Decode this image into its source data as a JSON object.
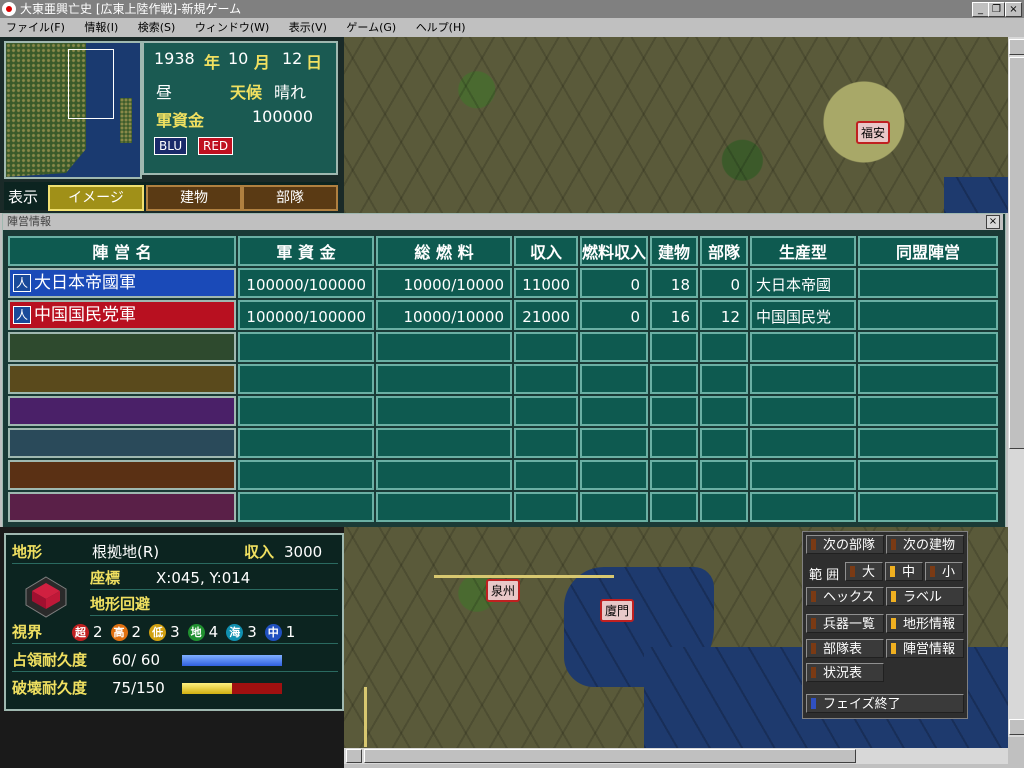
{
  "window": {
    "title": "大東亜興亡史 [広東上陸作戦]-新規ゲーム"
  },
  "menu": [
    {
      "label": "ファイル(F)"
    },
    {
      "label": "情報(I)"
    },
    {
      "label": "検索(S)"
    },
    {
      "label": "ウィンドウ(W)"
    },
    {
      "label": "表示(V)"
    },
    {
      "label": "ゲーム(G)"
    },
    {
      "label": "ヘルプ(H)"
    }
  ],
  "info": {
    "year": "1938",
    "year_unit": "年",
    "month": "10",
    "month_unit": "月",
    "day": "12",
    "day_unit": "日",
    "time_of_day": "昼",
    "weather_label": "天候",
    "weather": "晴れ",
    "funds_label": "軍資金",
    "funds": "100000",
    "side_blue": "BLU",
    "side_red": "RED"
  },
  "display_tabs": {
    "label": "表示",
    "tabs": [
      "イメージ",
      "建物",
      "部隊"
    ]
  },
  "map_labels": {
    "town_top": "福安",
    "town_left": "泉州",
    "town_right": "廈門"
  },
  "faction_dialog": {
    "title": "陣営情報",
    "close": "×",
    "headers": [
      "陣 営 名",
      "軍 資 金",
      "総 燃 料",
      "収入",
      "燃料収入",
      "建物",
      "部隊",
      "生産型",
      "同盟陣営"
    ],
    "rows": [
      {
        "icon": "人",
        "name": "大日本帝國軍",
        "funds": "100000/100000",
        "fuel": "10000/10000",
        "income": "11000",
        "fuel_income": "0",
        "buildings": "18",
        "units": "0",
        "production": "大日本帝國",
        "alliance": "",
        "color": "#1a4ab8"
      },
      {
        "icon": "人",
        "name": "中国国民党軍",
        "funds": "100000/100000",
        "fuel": "10000/10000",
        "income": "21000",
        "fuel_income": "0",
        "buildings": "16",
        "units": "12",
        "production": "中国国民党",
        "alliance": "",
        "color": "#b81020"
      },
      {
        "icon": "",
        "name": "",
        "funds": "",
        "fuel": "",
        "income": "",
        "fuel_income": "",
        "buildings": "",
        "units": "",
        "production": "",
        "alliance": "",
        "color": "#2e4a2e"
      },
      {
        "icon": "",
        "name": "",
        "funds": "",
        "fuel": "",
        "income": "",
        "fuel_income": "",
        "buildings": "",
        "units": "",
        "production": "",
        "alliance": "",
        "color": "#5a4a1c"
      },
      {
        "icon": "",
        "name": "",
        "funds": "",
        "fuel": "",
        "income": "",
        "fuel_income": "",
        "buildings": "",
        "units": "",
        "production": "",
        "alliance": "",
        "color": "#4a2068"
      },
      {
        "icon": "",
        "name": "",
        "funds": "",
        "fuel": "",
        "income": "",
        "fuel_income": "",
        "buildings": "",
        "units": "",
        "production": "",
        "alliance": "",
        "color": "#2a4a5a"
      },
      {
        "icon": "",
        "name": "",
        "funds": "",
        "fuel": "",
        "income": "",
        "fuel_income": "",
        "buildings": "",
        "units": "",
        "production": "",
        "alliance": "",
        "color": "#5a3014"
      },
      {
        "icon": "",
        "name": "",
        "funds": "",
        "fuel": "",
        "income": "",
        "fuel_income": "",
        "buildings": "",
        "units": "",
        "production": "",
        "alliance": "",
        "color": "#5a2048"
      }
    ]
  },
  "terrain": {
    "terrain_label": "地形",
    "terrain_value": "根拠地(R)",
    "income_label": "収入",
    "income_value": "3000",
    "coord_label": "座標",
    "coord_value": "X:045, Y:014",
    "evasion_label": "地形回避",
    "vision_label": "視界",
    "vision": [
      {
        "icon": "超",
        "value": "2",
        "color": "#c02020"
      },
      {
        "icon": "高",
        "value": "2",
        "color": "#e07010"
      },
      {
        "icon": "低",
        "value": "3",
        "color": "#d0a010"
      },
      {
        "icon": "地",
        "value": "4",
        "color": "#209030"
      },
      {
        "icon": "海",
        "value": "3",
        "color": "#1090b0"
      },
      {
        "icon": "中",
        "value": "1",
        "color": "#2050c0"
      }
    ],
    "occupy_label": "占領耐久度",
    "occupy_value": "60/ 60",
    "occupy_ratio": 1.0,
    "destroy_label": "破壊耐久度",
    "destroy_value": "75/150",
    "destroy_ratio": 0.5
  },
  "commands": {
    "next_unit": "次の部隊",
    "next_building": "次の建物",
    "range_label": "範 囲",
    "range_large": "大",
    "range_medium": "中",
    "range_small": "小",
    "hex": "ヘックス",
    "label": "ラベル",
    "weapons_list": "兵器一覧",
    "terrain_info": "地形情報",
    "unit_table": "部隊表",
    "faction_info": "陣営情報",
    "status_table": "状況表",
    "end_phase": "フェイズ終了"
  }
}
